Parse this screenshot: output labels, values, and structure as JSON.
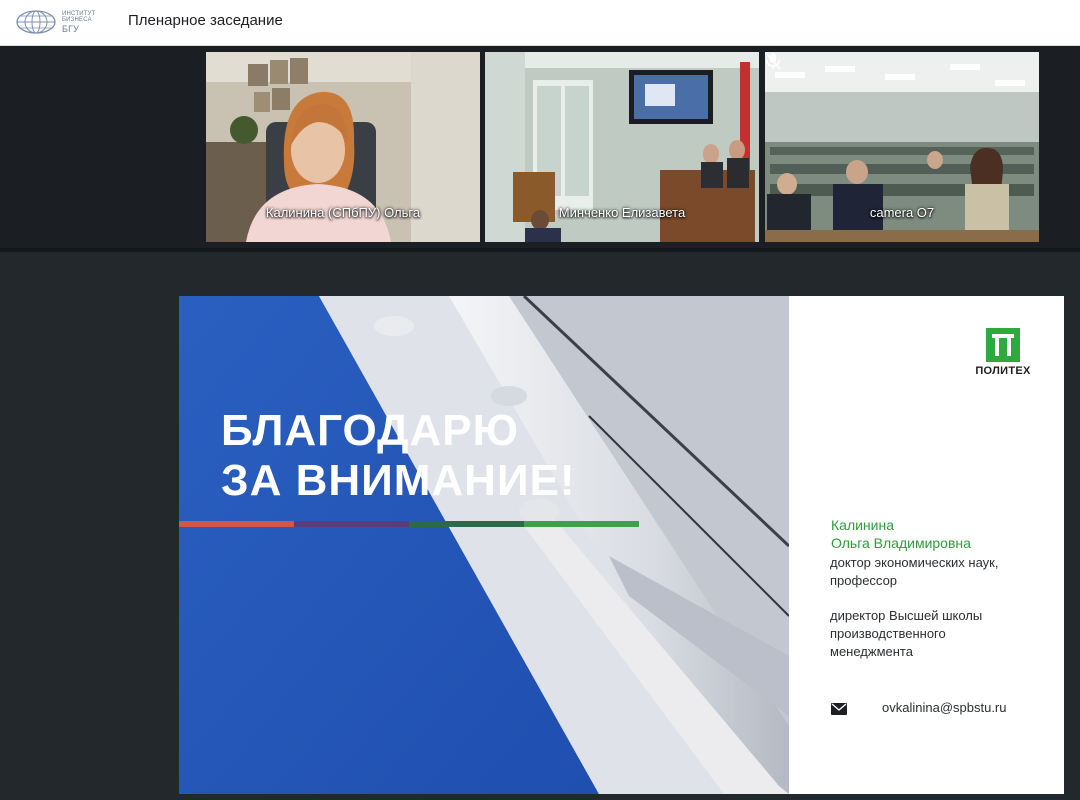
{
  "header": {
    "logo_lines": [
      "ИНСТИТУТ",
      "БИЗНЕСА",
      "БГУ"
    ],
    "meeting_title": "Пленарное заседание"
  },
  "participants": [
    {
      "name": "Калинина (СПбПУ) Ольга",
      "icon": "person-video"
    },
    {
      "name": "Минченко Елизавета",
      "icon": "room-video"
    },
    {
      "name": "camera O7",
      "icon": "auditorium-video",
      "mic_muted": true
    }
  ],
  "slide": {
    "title_lines": [
      "БЛАГОДАРЮ",
      "ЗА ВНИМАНИЕ!"
    ],
    "logo_label": "ПОЛИТЕХ",
    "author_name_lines": [
      "Калинина",
      "Ольга Владимировна"
    ],
    "degree_lines": [
      "доктор экономических наук,",
      "профессор"
    ],
    "position_lines": [
      "директор Высшей школы",
      "производственного",
      "менеджмента"
    ],
    "email": "ovkalinina@spbstu.ru",
    "colors": {
      "accent_green": "#2e9c3a",
      "slide_blue": "#2458b8",
      "stripe": [
        "#d2574a",
        "#5a3d7a",
        "#2e6a4a",
        "#3ea04a"
      ]
    }
  }
}
